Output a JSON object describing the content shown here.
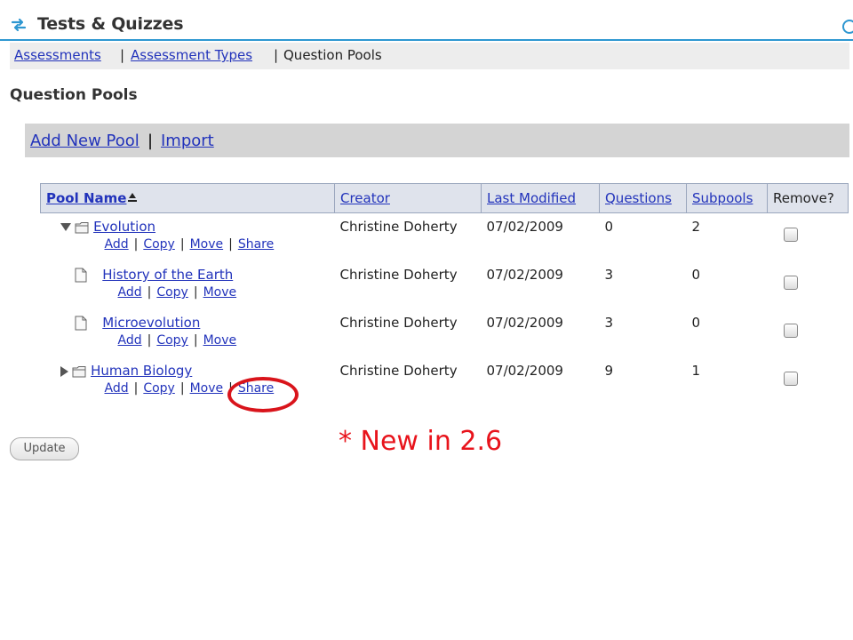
{
  "app": {
    "title": "Tests & Quizzes"
  },
  "nav": {
    "assessments": "Assessments",
    "sep1": "|",
    "assessment_types": "Assessment Types",
    "sep2": "|",
    "question_pools": "Question Pools"
  },
  "page": {
    "heading": "Question Pools"
  },
  "actions": {
    "add_new_pool": "Add New Pool",
    "sep": "|",
    "import": "Import"
  },
  "table": {
    "headers": {
      "pool_name": "Pool Name",
      "creator": "Creator",
      "last_modified": "Last Modified",
      "questions": "Questions",
      "subpools": "Subpools",
      "remove": "Remove?"
    },
    "rows": [
      {
        "name": "Evolution",
        "expander": "expanded",
        "icon": "folder-icon",
        "creator": "Christine Doherty",
        "modified": "07/02/2009",
        "questions": "0",
        "subpools": "2",
        "actions": [
          "Add",
          "Copy",
          "Move",
          "Share"
        ],
        "removed": false
      },
      {
        "name": "History of the Earth",
        "icon": "document-icon",
        "creator": "Christine Doherty",
        "modified": "07/02/2009",
        "questions": "3",
        "subpools": "0",
        "actions": [
          "Add",
          "Copy",
          "Move"
        ],
        "removed": false
      },
      {
        "name": "Microevolution",
        "icon": "document-icon",
        "creator": "Christine Doherty",
        "modified": "07/02/2009",
        "questions": "3",
        "subpools": "0",
        "actions": [
          "Add",
          "Copy",
          "Move"
        ],
        "removed": false
      },
      {
        "name": "Human Biology",
        "expander": "collapsed",
        "icon": "folder-icon",
        "creator": "Christine Doherty",
        "modified": "07/02/2009",
        "questions": "9",
        "subpools": "1",
        "actions": [
          "Add",
          "Copy",
          "Move",
          "Share"
        ],
        "removed": false
      }
    ]
  },
  "buttons": {
    "update": "Update"
  },
  "annotation": {
    "text": "* New in 2.6",
    "color": "#e8141c"
  },
  "colors": {
    "link": "#2233bb",
    "accent": "#2e97d1",
    "header_bg": "#dfe3ec",
    "actionbar_bg": "#d4d4d4"
  }
}
